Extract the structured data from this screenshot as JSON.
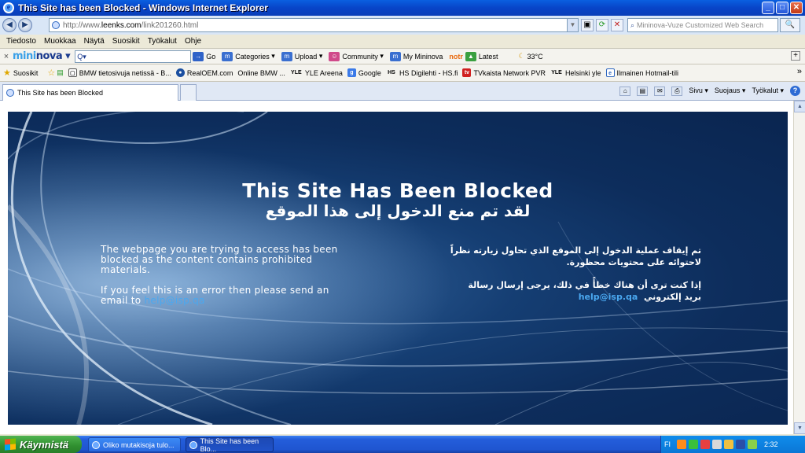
{
  "window": {
    "title": "This Site has been Blocked - Windows Internet Explorer",
    "buttons": {
      "minimize": "_",
      "maximize": "□",
      "close": "✕"
    }
  },
  "addressbar": {
    "back": "◀",
    "forward": "▶",
    "url_prefix": "http://www.",
    "url_host": "leenks.com",
    "url_path": "/link201260.html",
    "search_placeholder": "Mininova-Vuze Customized Web Search",
    "search_button": "🔍"
  },
  "menubar": {
    "items": [
      "Tiedosto",
      "Muokkaa",
      "Näytä",
      "Suosikit",
      "Työkalut",
      "Ohje"
    ]
  },
  "mininova_toolbar": {
    "close": "×",
    "logo_mini": "mini",
    "logo_nova": "nova",
    "search_value": "Q▾",
    "go": "Go",
    "items": [
      "Categories",
      "Upload",
      "Community",
      "My Mininova",
      "Latest"
    ],
    "weather": "33°C",
    "notr_label": "notr"
  },
  "favorites": {
    "label": "Suosikit",
    "items": [
      "BMW tietosivuja netissä - B...",
      "RealOEM.com",
      "Online BMW ...",
      "YLE Areena",
      "Google",
      "HS Digilehti - HS.fi",
      "TVkaista Network PVR",
      "Helsinki yle",
      "Ilmainen Hotmail-tili"
    ],
    "icons": [
      "bmw",
      "bmw-logo",
      "",
      "yle",
      "google",
      "hs",
      "tvkaista",
      "yle",
      "msn"
    ],
    "overflow": "»"
  },
  "tabs": {
    "active_tab": "This Site has been Blocked",
    "commands": [
      "Sivu",
      "Suojaus",
      "Työkalut"
    ]
  },
  "blocked_page": {
    "title_en": "This Site Has Been Blocked",
    "title_ar": "لقد تم منع الدخول إلى هذا الموقع",
    "body_en_1": "The webpage you are trying to access has been blocked as the content contains prohibited materials.",
    "body_en_2": "If you feel this is an error then please send an email to",
    "email": "help@isp.qa",
    "body_ar_1": "تم إيقاف عملية الدخول إلى الموقع الذي تحاول زيارته نظراً لاحتوائه على محتويات محظورة.",
    "body_ar_2": "إذا كنت ترى أن هناك خطأً في ذلك، يرجى إرسال رسالة بريد إلكتروني"
  },
  "taskbar": {
    "start": "Käynnistä",
    "items": [
      "Oliko mutakisoja tulo...",
      "This Site has been Blo..."
    ],
    "lang": "FI",
    "clock": "2:32"
  },
  "colors": {
    "accent": "#0a5fe0",
    "panel_dark": "#0d2d5c",
    "link": "#4aa8f0"
  }
}
